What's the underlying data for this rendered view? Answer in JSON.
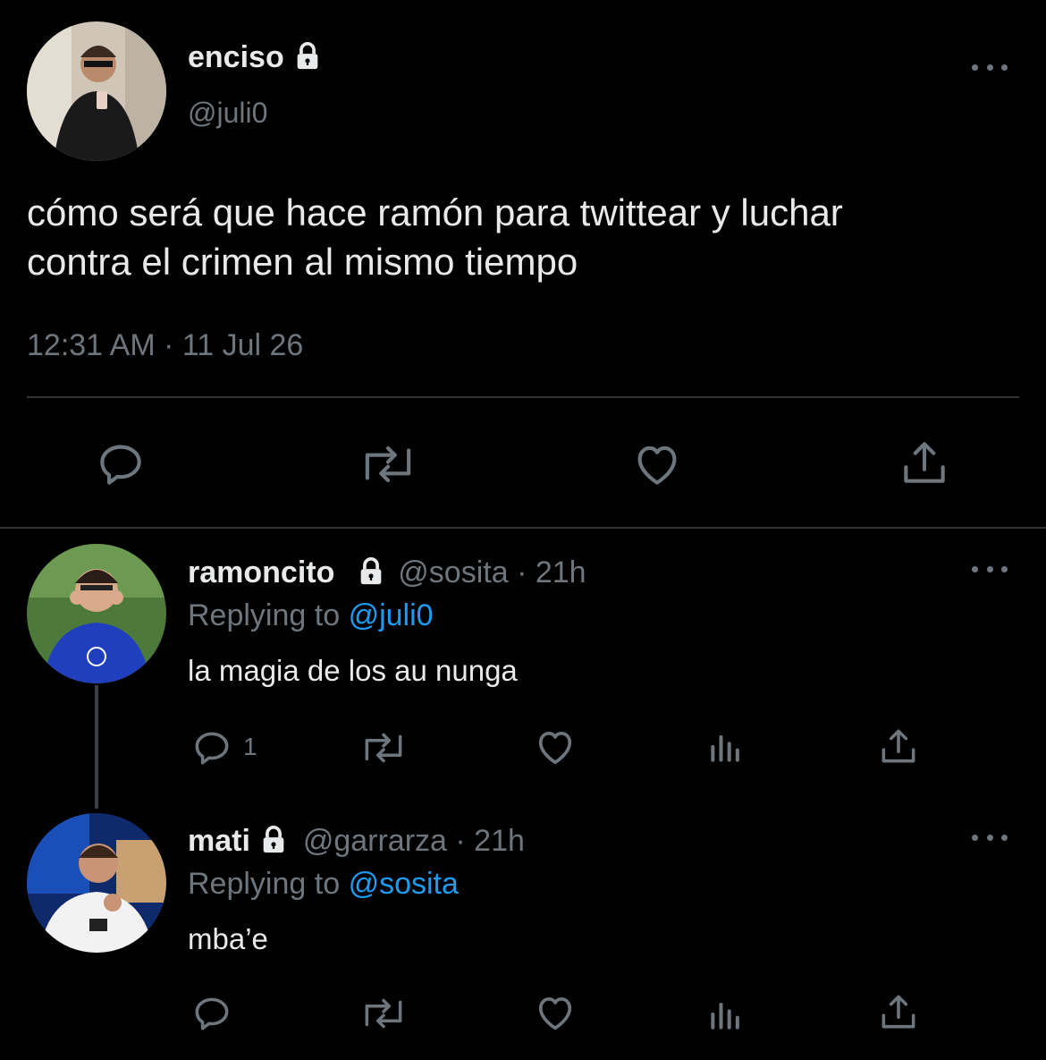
{
  "main_tweet": {
    "display_name": "enciso",
    "handle": "@juli0",
    "text_line1": "cómo será que hace ramón para twittear y luchar",
    "text_line2": "contra el crimen al mismo tiempo",
    "timestamp": "12:31 AM · 11 Jul 26"
  },
  "replies": [
    {
      "display_name": "ramoncito",
      "handle": "@sosita",
      "time": "· 21h",
      "replying_prefix": "Replying to",
      "replying_to": "@juli0",
      "text": "la magia de los au nunga",
      "reply_count": "1"
    },
    {
      "display_name": "mati",
      "handle": "@garrarza",
      "time": "· 21h",
      "replying_prefix": "Replying to",
      "replying_to": "@sosita",
      "text": "mba’e",
      "reply_count": ""
    }
  ],
  "icons": {
    "reply": "reply-icon",
    "retweet": "retweet-icon",
    "like": "like-icon",
    "share": "share-icon",
    "analytics": "analytics-icon",
    "more": "more-icon",
    "lock": "lock-icon"
  },
  "colors": {
    "background": "#000000",
    "text": "#e7e9ea",
    "muted": "#6e767d",
    "link": "#1d9bf0",
    "divider": "#2f3336"
  }
}
